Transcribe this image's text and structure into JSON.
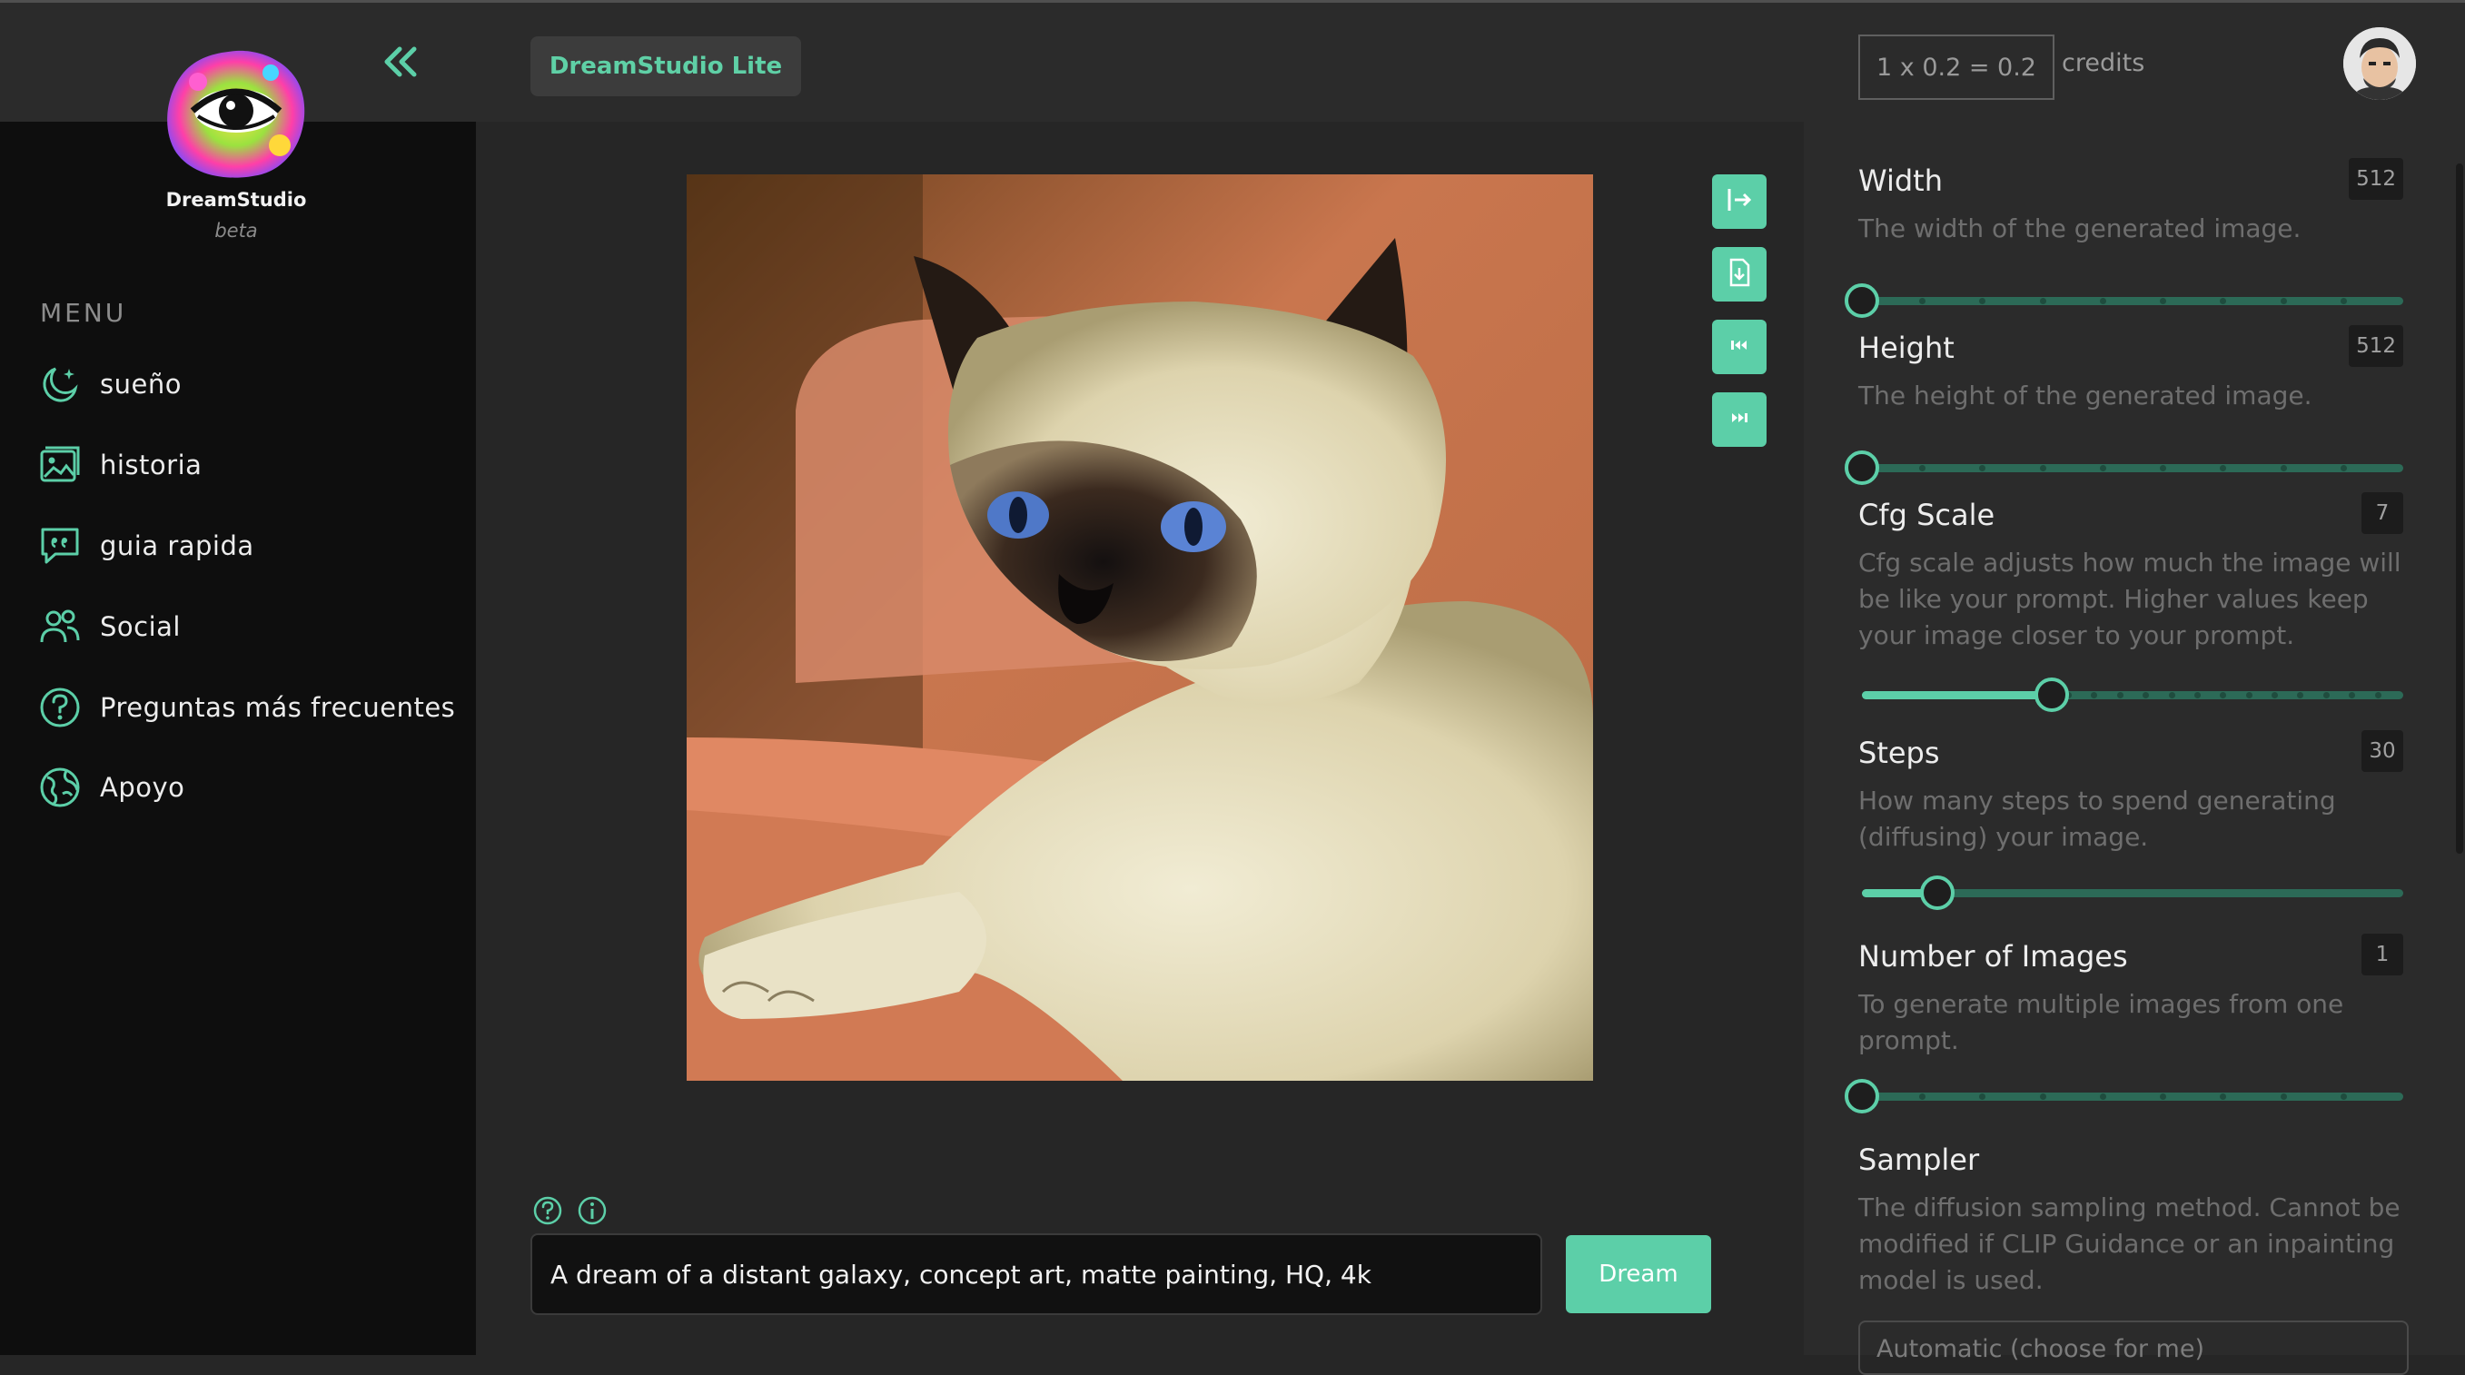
{
  "brand": {
    "name": "DreamStudio",
    "tag": "beta"
  },
  "header": {
    "app_name": "DreamStudio Lite",
    "credits_formula": "1 x 0.2 = 0.2",
    "credits_label": "credits"
  },
  "sidebar": {
    "menu_title": "MENU",
    "items": [
      {
        "label": "sueño",
        "icon": "moon-sparkle-icon"
      },
      {
        "label": "historia",
        "icon": "image-gallery-icon"
      },
      {
        "label": "guia rapida",
        "icon": "quote-bubble-icon"
      },
      {
        "label": "Social",
        "icon": "users-icon"
      },
      {
        "label": "Preguntas más frecuentes",
        "icon": "question-circle-icon"
      },
      {
        "label": "Apoyo",
        "icon": "support-globe-icon"
      }
    ]
  },
  "settings": {
    "width": {
      "title": "Width",
      "value": "512",
      "desc": "The width of the generated image.",
      "level": 0
    },
    "height": {
      "title": "Height",
      "value": "512",
      "desc": "The height of the generated image.",
      "level": 0
    },
    "cfg": {
      "title": "Cfg Scale",
      "value": "7",
      "desc": "Cfg scale adjusts how much the image will be like your prompt. Higher values keep your image closer to your prompt.",
      "level": 0.35
    },
    "steps": {
      "title": "Steps",
      "value": "30",
      "desc": "How many steps to spend generating (diffusing) your image.",
      "level": 0.14
    },
    "num_images": {
      "title": "Number of Images",
      "value": "1",
      "desc": "To generate multiple images from one prompt.",
      "level": 0
    },
    "sampler": {
      "title": "Sampler",
      "desc": "The diffusion sampling method. Cannot be modified if CLIP Guidance or an inpainting model is used.",
      "selected": "Automatic (choose for me)"
    }
  },
  "prompt": {
    "value": "A dream of a distant galaxy, concept art, matte painting, HQ, 4k"
  },
  "dream_button": "Dream",
  "colors": {
    "accent": "#5ccfa8",
    "accent_dark": "#2c6a57",
    "sidebar_bg": "#0e0e0e",
    "panel_bg": "#2b2b2b"
  }
}
